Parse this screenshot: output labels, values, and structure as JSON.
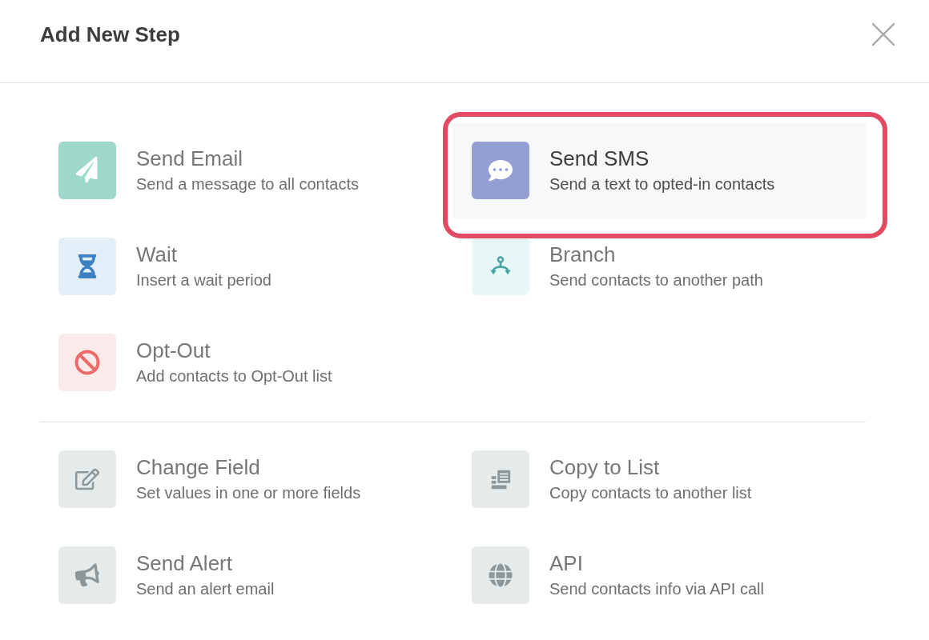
{
  "dialog": {
    "title": "Add New Step"
  },
  "sections": [
    {
      "items": [
        {
          "kind": "email",
          "title": "Send Email",
          "description": "Send a message to all contacts",
          "selected": false,
          "highlighted": false
        },
        {
          "kind": "sms",
          "title": "Send SMS",
          "description": "Send a text to opted-in contacts",
          "selected": true,
          "highlighted": true
        },
        {
          "kind": "wait",
          "title": "Wait",
          "description": "Insert a wait period",
          "selected": false,
          "highlighted": false
        },
        {
          "kind": "branch",
          "title": "Branch",
          "description": "Send contacts to another path",
          "selected": false,
          "highlighted": false
        },
        {
          "kind": "opt_out",
          "title": "Opt-Out",
          "description": "Add contacts to Opt-Out list",
          "selected": false,
          "highlighted": false
        }
      ]
    },
    {
      "items": [
        {
          "kind": "field",
          "title": "Change Field",
          "description": "Set values in one or more fields",
          "selected": false,
          "highlighted": false
        },
        {
          "kind": "copy",
          "title": "Copy to List",
          "description": "Copy contacts to another list",
          "selected": false,
          "highlighted": false
        },
        {
          "kind": "alert",
          "title": "Send Alert",
          "description": "Send an alert email",
          "selected": false,
          "highlighted": false
        },
        {
          "kind": "api",
          "title": "API",
          "description": "Send contacts info via API call",
          "selected": false,
          "highlighted": false
        }
      ]
    }
  ]
}
